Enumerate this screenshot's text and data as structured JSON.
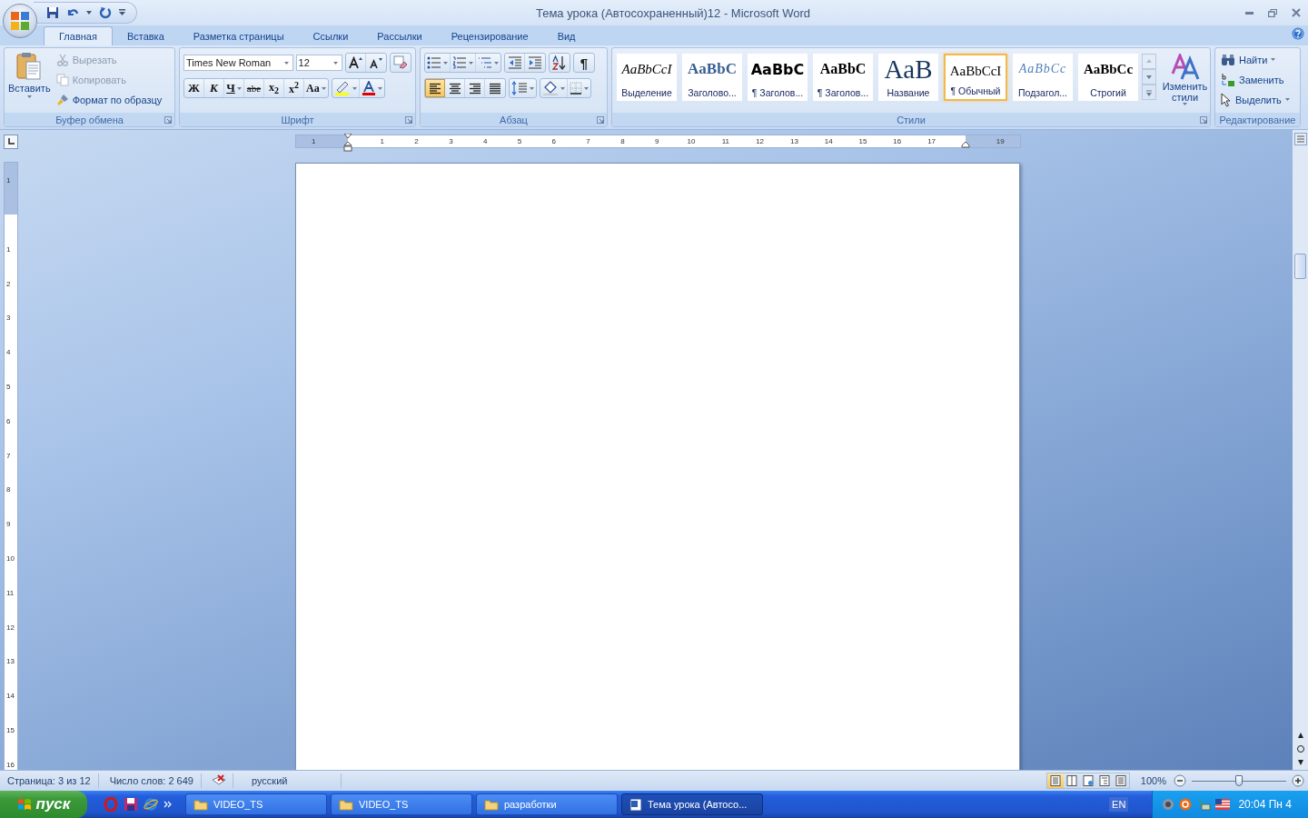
{
  "window": {
    "title": "Тема урока (Автосохраненный)12 - Microsoft Word"
  },
  "tabs": [
    {
      "label": "Главная",
      "selected": true
    },
    {
      "label": "Вставка",
      "selected": false
    },
    {
      "label": "Разметка страницы",
      "selected": false
    },
    {
      "label": "Ссылки",
      "selected": false
    },
    {
      "label": "Рассылки",
      "selected": false
    },
    {
      "label": "Рецензирование",
      "selected": false
    },
    {
      "label": "Вид",
      "selected": false
    }
  ],
  "clipboard": {
    "label": "Буфер обмена",
    "paste": "Вставить",
    "commands": [
      {
        "kind": "cut",
        "label": "Вырезать",
        "disabled": true
      },
      {
        "kind": "copy",
        "label": "Копировать",
        "disabled": true
      },
      {
        "kind": "format",
        "label": "Формат по образцу",
        "disabled": false
      }
    ]
  },
  "font": {
    "label": "Шрифт",
    "name": "Times New Roman",
    "size": "12",
    "format_buttons": [
      {
        "kind": "bold",
        "label": "Ж",
        "menu": false
      },
      {
        "kind": "italic",
        "label": "К",
        "menu": false
      },
      {
        "kind": "underline",
        "label": "Ч",
        "menu": true
      },
      {
        "kind": "strike",
        "label": "abe",
        "menu": false
      },
      {
        "kind": "plain",
        "label": "x$_{2}$",
        "menu": false
      },
      {
        "kind": "plain",
        "label": "x$^{2}$",
        "menu": false
      },
      {
        "kind": "plain",
        "label": "Aa",
        "menu": true
      }
    ]
  },
  "paragraph": {
    "label": "Абзац",
    "show_marks": "¶",
    "alignments": [
      {
        "kind": "left",
        "selected": true
      },
      {
        "kind": "center",
        "selected": false
      },
      {
        "kind": "right",
        "selected": false
      },
      {
        "kind": "justify",
        "selected": false
      }
    ]
  },
  "styles": {
    "label": "Стили",
    "items": [
      {
        "kind": "emphasis",
        "sample": "AaBbCcI",
        "name": "Выделение",
        "selected": false
      },
      {
        "kind": "heading",
        "sample": "AaBbC",
        "name": "Заголово...",
        "selected": false
      },
      {
        "kind": "heading1",
        "sample": "AaBbC",
        "name": "¶ Заголов...",
        "selected": false
      },
      {
        "kind": "heading2",
        "sample": "AaBbC",
        "name": "¶ Заголов...",
        "selected": false
      },
      {
        "kind": "title",
        "sample": "AaB",
        "name": "Название",
        "selected": false
      },
      {
        "kind": "normal",
        "sample": "AaBbCcI",
        "name": "¶ Обычный",
        "selected": true
      },
      {
        "kind": "subtitle",
        "sample": "AaBbCc",
        "name": "Подзагол...",
        "selected": false
      },
      {
        "kind": "strong",
        "sample": "AaBbCc",
        "name": "Строгий",
        "selected": false
      }
    ],
    "change_styles": "Изменить стили"
  },
  "editing": {
    "label": "Редактирование",
    "commands": [
      {
        "kind": "find",
        "label": "Найти",
        "menu": true
      },
      {
        "kind": "replace",
        "label": "Заменить",
        "menu": false
      },
      {
        "kind": "select",
        "label": "Выделить",
        "menu": true
      }
    ]
  },
  "ruler": {
    "horizontal": [
      "1",
      "1",
      "2",
      "3",
      "4",
      "5",
      "6",
      "7",
      "8",
      "9",
      "10",
      "11",
      "12",
      "13",
      "14",
      "15",
      "16",
      "17",
      "19"
    ],
    "vertical": [
      "1",
      "1",
      "2",
      "3",
      "4",
      "5",
      "6",
      "7",
      "8",
      "9",
      "10",
      "11",
      "12",
      "13",
      "14",
      "15",
      "16"
    ]
  },
  "status_bar": {
    "page": "Страница: 3 из 12",
    "words": "Число слов: 2 649",
    "language": "русский",
    "views": [
      {
        "kind": "print",
        "selected": true
      },
      {
        "kind": "reading",
        "selected": false
      },
      {
        "kind": "web",
        "selected": false
      },
      {
        "kind": "outline",
        "selected": false
      },
      {
        "kind": "draft",
        "selected": false
      }
    ],
    "zoom": "100%",
    "zoom_slider": {
      "level": 0.5
    }
  },
  "taskbar": {
    "start": "пуск",
    "tasks": [
      {
        "kind": "folder",
        "label": "VIDEO_TS",
        "selected": false
      },
      {
        "kind": "folder",
        "label": "VIDEO_TS",
        "selected": false
      },
      {
        "kind": "folder",
        "label": "разработки",
        "selected": false
      },
      {
        "kind": "document",
        "label": "Тема урока (Автосо...",
        "selected": true
      }
    ],
    "language": "EN",
    "clock": "20:04 Пн 4"
  }
}
